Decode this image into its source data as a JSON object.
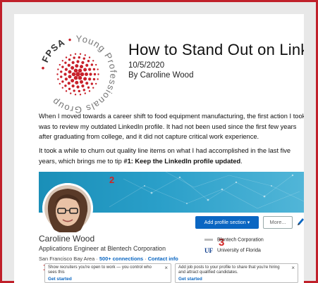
{
  "article": {
    "logo": {
      "org": "FPSA",
      "text": "Young Professionals Group",
      "dot_color": "#c8202a"
    },
    "title": "How to Stand Out on LinkedIn",
    "date": "10/5/2020",
    "byline": "By Caroline Wood",
    "paragraph1": "When I moved towards a career shift to food equipment manufacturing, the first action I took was to review my outdated LinkedIn profile.  It had not been used since the first few years after graduating from college, and it did not capture critical work experience.",
    "paragraph2_plain": "It took a while to churn out quality line items on what I had accomplished in the last five years, which brings me to tip ",
    "paragraph2_bold": "#1: Keep the LinkedIn profile updated",
    "paragraph2_end": "."
  },
  "profile": {
    "name": "Caroline Wood",
    "headline": "Applications Engineer at Blentech Corporation",
    "location": "San Francisco Bay Area",
    "connections": "500+ connections",
    "contact_info": "Contact info",
    "add_section_button": "Add profile section",
    "more_button": "More...",
    "companies": [
      {
        "name": "Blentech Corporation",
        "icon": "company-logo-icon"
      },
      {
        "name": "University of Florida",
        "icon": "uf-logo-icon"
      }
    ],
    "annotations": {
      "one": "1",
      "two": "2",
      "three": "3"
    },
    "card_open_to_work": {
      "text": "Show recruiters you're open to work — you control who sees this",
      "link": "Get started",
      "close": "×"
    },
    "card_job_posts": {
      "text": "Add job posts to your profile to share that you're hiring and attract qualified candidates.",
      "link": "Get started",
      "close": "×"
    }
  },
  "colors": {
    "frame": "#c0202a",
    "linkedin_blue": "#0a66c2",
    "annotation_red": "#d42222",
    "banner": "#2a9fc9"
  }
}
